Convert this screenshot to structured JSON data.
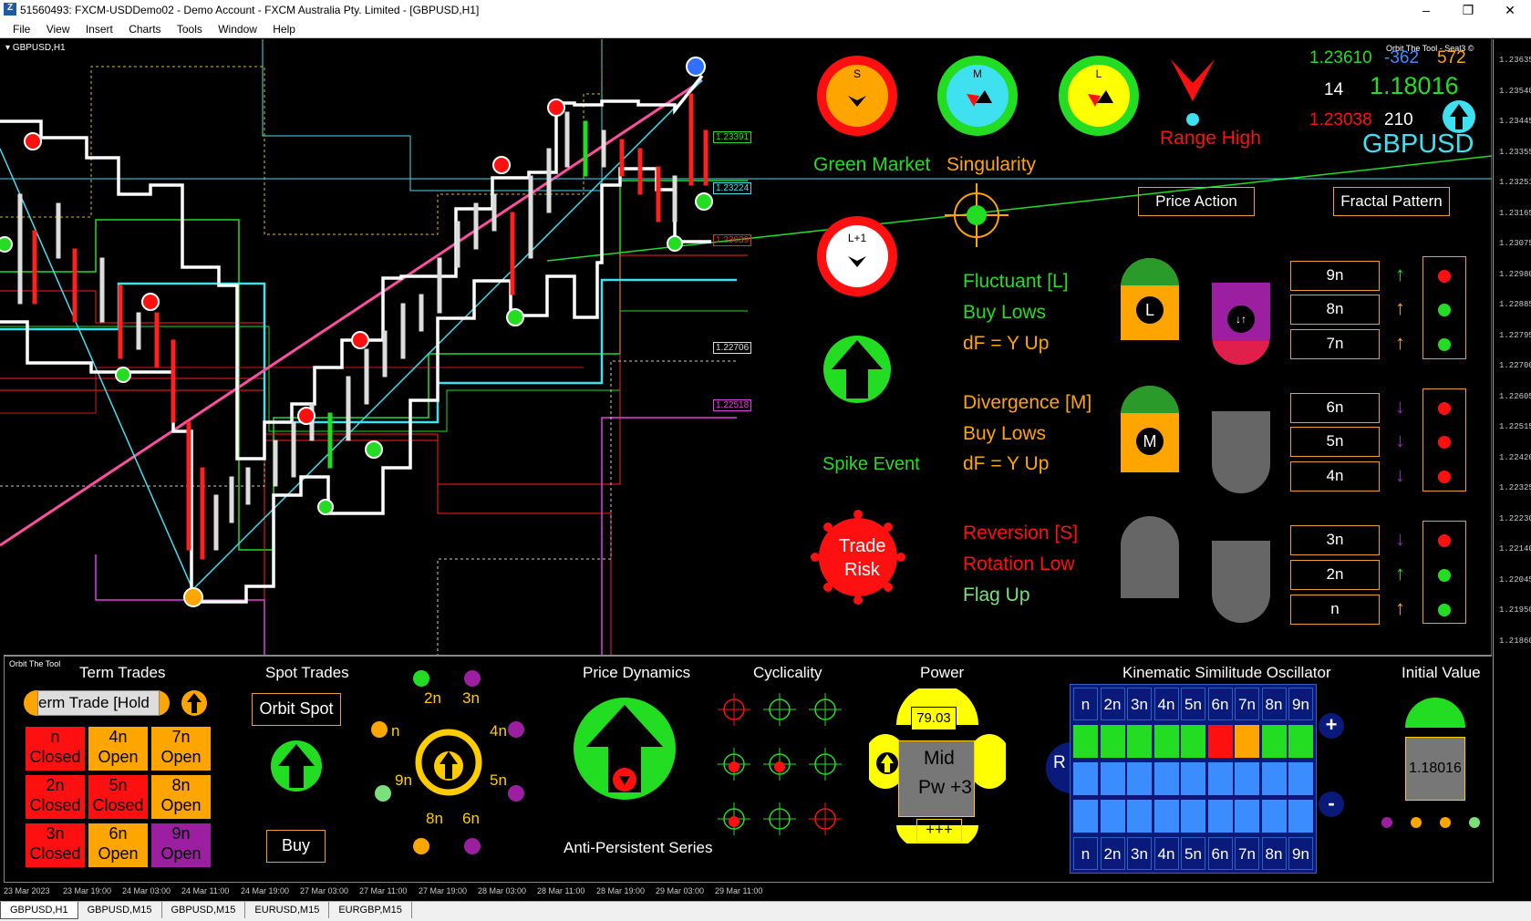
{
  "window": {
    "title": "51560493: FXCM-USDDemo02 - Demo Account - FXCM Australia Pty. Limited - [GBPUSD,H1]",
    "controls": [
      "–",
      "❐",
      "✕"
    ]
  },
  "menu": [
    "File",
    "View",
    "Insert",
    "Charts",
    "Tools",
    "Window",
    "Help"
  ],
  "chart": {
    "symbol_label": "GBPUSD,H1",
    "tool_label": "Orbit The Tool - Seal3 ©",
    "price_labels": [
      "1.23391",
      "1.23224",
      "1.23039",
      "1.22706",
      "1.22518"
    ],
    "price_ticks": [
      "1.23635",
      "1.23540",
      "1.23445",
      "1.23355",
      "1.23251",
      "1.23165",
      "1.23075",
      "1.22980",
      "1.22885",
      "1.22795",
      "1.22700",
      "1.22605",
      "1.22515",
      "1.22420",
      "1.22325",
      "1.22230",
      "1.22140",
      "1.22045",
      "1.21950",
      "1.21860"
    ],
    "time_ticks": [
      "23 Mar 2023",
      "23 Mar 19:00",
      "24 Mar 03:00",
      "24 Mar 11:00",
      "24 Mar 19:00",
      "27 Mar 03:00",
      "27 Mar 11:00",
      "27 Mar 19:00",
      "28 Mar 03:00",
      "28 Mar 11:00",
      "28 Mar 19:00",
      "29 Mar 03:00",
      "29 Mar 11:00"
    ]
  },
  "hud": {
    "dials": [
      {
        "label": "S"
      },
      {
        "label": "M"
      },
      {
        "label": "L"
      }
    ],
    "l1_label": "L+1",
    "green_market": "Green Market",
    "singularity": "Singularity",
    "range_high": "Range High",
    "quote": {
      "high": "1.23610",
      "change": "-362",
      "count": "572",
      "n": "14",
      "price": "1.18016",
      "low": "1.23038",
      "count2": "210",
      "pair": "GBPUSD"
    },
    "price_action": "Price Action",
    "fractal_pattern": "Fractal Pattern",
    "spike_event": "Spike Event",
    "trade_risk": [
      "Trade",
      "Risk"
    ],
    "groups": [
      {
        "lines": [
          "Fluctuant [L]",
          "Buy Lows",
          "dF = Y Up"
        ],
        "colors": [
          "#22dd22",
          "#22dd22",
          "#ffa500"
        ],
        "badge": "L",
        "rows": [
          "9n",
          "8n",
          "7n"
        ],
        "arrows": [
          "up",
          "up",
          "up"
        ],
        "arrow_colors": [
          "#22dd22",
          "#ffa500",
          "#ffa500"
        ],
        "dots": [
          "#ff1010",
          "#22dd22",
          "#22dd22"
        ]
      },
      {
        "lines": [
          "Divergence [M]",
          "Buy Lows",
          "dF = Y Up"
        ],
        "colors": [
          "#ffa500",
          "#ffa500",
          "#ffa500"
        ],
        "badge": "M",
        "rows": [
          "6n",
          "5n",
          "4n"
        ],
        "arrows": [
          "down",
          "down",
          "down"
        ],
        "arrow_colors": [
          "#a020c0",
          "#a020c0",
          "#a020c0"
        ],
        "dots": [
          "#ff1010",
          "#ff1010",
          "#ff1010"
        ]
      },
      {
        "lines": [
          "Reversion [S]",
          "Rotation Low",
          "Flag Up"
        ],
        "colors": [
          "#ff1010",
          "#ff1010",
          "#7be07b"
        ],
        "badge": "",
        "rows": [
          "3n",
          "2n",
          "n"
        ],
        "arrows": [
          "down",
          "up",
          "up"
        ],
        "arrow_colors": [
          "#a020c0",
          "#22dd22",
          "#ffa500"
        ],
        "dots": [
          "#ff1010",
          "#22dd22",
          "#22dd22"
        ]
      }
    ]
  },
  "panel": {
    "corner_label": "Orbit The Tool",
    "term_trades": {
      "title": "Term Trades",
      "input_value": "erm Trade [Hold",
      "cells": [
        [
          "n",
          "Closed"
        ],
        [
          "4n",
          "Open"
        ],
        [
          "7n",
          "Open"
        ],
        [
          "2n",
          "Closed"
        ],
        [
          "5n",
          "Closed"
        ],
        [
          "8n",
          "Open"
        ],
        [
          "3n",
          "Closed"
        ],
        [
          "6n",
          "Open"
        ],
        [
          "9n",
          "Open"
        ]
      ],
      "cell_colors": [
        "#ff1010",
        "#ffa500",
        "#ffa500",
        "#ff1010",
        "#ff1010",
        "#ffa500",
        "#ff1010",
        "#ffa500",
        "#9b1fa0"
      ]
    },
    "spot_trades": {
      "title": "Spot Trades",
      "button": "Orbit Spot",
      "buy": "Buy"
    },
    "orbit": {
      "labels": [
        "2n",
        "3n",
        "n",
        "4n",
        "9n",
        "5n",
        "8n",
        "6n"
      ]
    },
    "price_dynamics": {
      "title": "Price Dynamics",
      "footer": "Anti-Persistent Series"
    },
    "cyclicality": {
      "title": "Cyclicality"
    },
    "power": {
      "title": "Power",
      "value": "79.03",
      "mid": "Mid",
      "pw": "Pw +3",
      "plus": "+++"
    },
    "kso": {
      "title": "Kinematic Similitude Oscillator",
      "cols": [
        "n",
        "2n",
        "3n",
        "4n",
        "5n",
        "6n",
        "7n",
        "8n",
        "9n"
      ],
      "row_colors": [
        "#22dd22",
        "#22dd22",
        "#22dd22",
        "#22dd22",
        "#22dd22",
        "#ff1010",
        "#ffa500",
        "#22dd22",
        "#22dd22"
      ],
      "r_label": "R",
      "plus": "+",
      "minus": "-"
    },
    "initial_value": {
      "title": "Initial Value",
      "value": "1.18016"
    }
  },
  "tabs": [
    "GBPUSD,H1",
    "GBPUSD,M15",
    "GBPUSD,M15",
    "EURUSD,M15",
    "EURGBP,M15"
  ]
}
